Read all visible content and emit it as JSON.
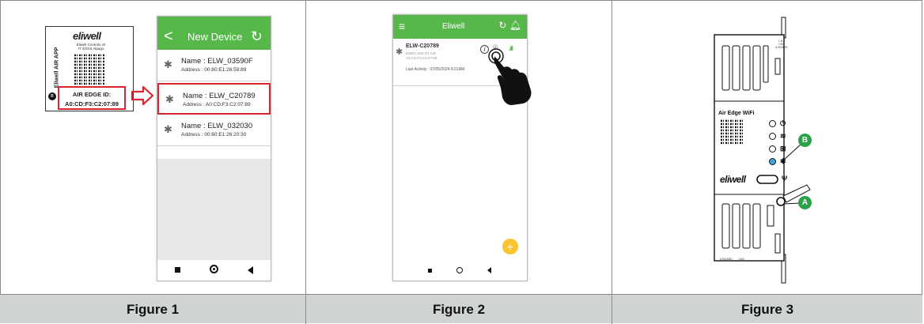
{
  "figures": [
    {
      "caption": "Figure 1"
    },
    {
      "caption": "Figure 2"
    },
    {
      "caption": "Figure 3"
    }
  ],
  "fig1": {
    "label": {
      "logo": "eliwell",
      "company": "Eliwell Controls srl\nIT 32016 Alpago",
      "side_text": "Eliwell AIR APP",
      "edge_title": "AIR EDGE ID:",
      "edge_id": "A0:CD:F3:C2:07:89"
    },
    "phone": {
      "back_icon": "chevron-left-icon",
      "title": "New Device",
      "refresh_icon": "refresh-icon",
      "devices": [
        {
          "name": "Name : ELW_03590F",
          "address": "Address : 00:80:E1:26:59:89"
        },
        {
          "name": "Name : ELW_C20789",
          "address": "Address : A0:CD:F3:C2:07:89"
        },
        {
          "name": "Name : ELW_032030",
          "address": "Address : 00:80:E1:26:20:30"
        }
      ]
    },
    "highlight_color": "#d8252f"
  },
  "fig2": {
    "phone": {
      "title": "Eliwell",
      "device": {
        "name": "ELW-C20789",
        "line1": "EWRC 500 NT AIR",
        "line2": "A0:CD:F3:C2:07:89",
        "activity": "Last Activity : 07/05/2024 8.01AM"
      },
      "fab_label": "+"
    }
  },
  "fig3": {
    "device_label": "Air Edge WiFi",
    "logo": "eliwell",
    "callouts": [
      "B",
      "A"
    ],
    "tiny_labels": {
      "top": "1   N   2\nCNX\n& BOARD",
      "bottom_left": "& BOARD        CN3"
    },
    "led_icons": [
      "power-icon",
      "wifi-icon",
      "network-icon",
      "bluetooth-icon"
    ]
  },
  "colors": {
    "brand_green": "#55b848",
    "callout_green": "#2aa24a",
    "caption_bg": "#d0d3d4",
    "fab_yellow": "#f8c531",
    "led_blue": "#3aa8e0"
  }
}
